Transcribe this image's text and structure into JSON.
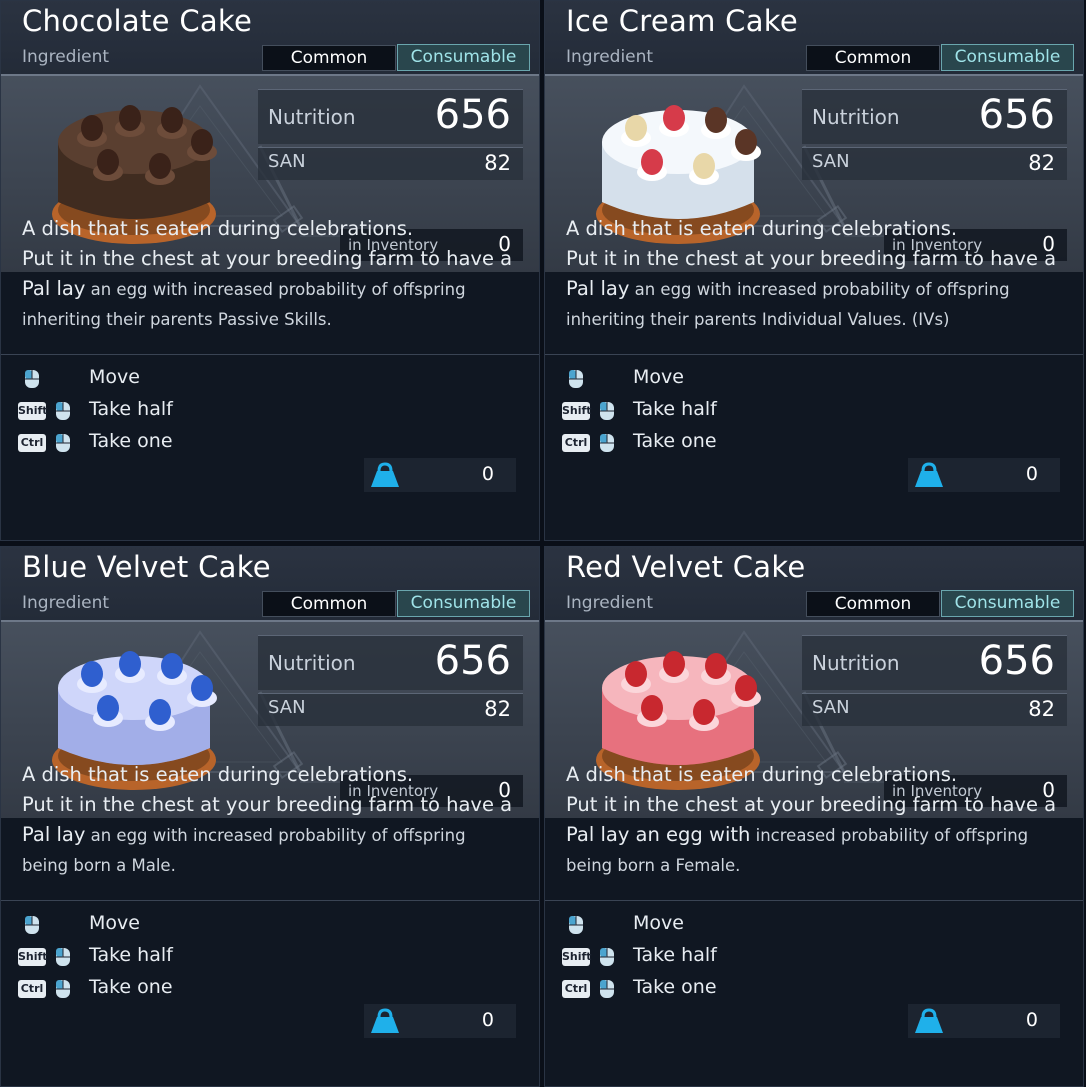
{
  "cards": [
    {
      "title": "Chocolate Cake",
      "category": "Ingredient",
      "rarity": "Common",
      "type": "Consumable",
      "nutrition_label": "Nutrition",
      "nutrition": "656",
      "san_label": "SAN",
      "san": "82",
      "inventory_label": "in Inventory",
      "inventory": "0",
      "desc_line1": "A dish that is eaten during celebrations.",
      "desc_line2": "Put it in the chest at your breeding farm to have a",
      "desc_line3_big": "Pal lay",
      "desc_line3_small": " an egg with increased probability of offspring",
      "desc_line4": "inheriting their parents Passive Skills.",
      "controls": {
        "move": "Move",
        "half_key": "Shift",
        "half": "Take half",
        "one_key": "Ctrl",
        "one": "Take one"
      },
      "weight": "0",
      "colors": {
        "body": "#4a3326",
        "body_dark": "#2e1f17",
        "top": "#5a3f30",
        "frosting": "#6d4c3a",
        "base": "#b8642a"
      },
      "toppings": [
        "#3a2219",
        "#3a2219",
        "#3a2219",
        "#3a2219",
        "#3a2219",
        "#3a2219"
      ],
      "icon_names": [
        "cake-icon",
        "mouse-icon",
        "weight-icon"
      ]
    },
    {
      "title": "Ice Cream Cake",
      "category": "Ingredient",
      "rarity": "Common",
      "type": "Consumable",
      "nutrition_label": "Nutrition",
      "nutrition": "656",
      "san_label": "SAN",
      "san": "82",
      "inventory_label": "in Inventory",
      "inventory": "0",
      "desc_line1": "A dish that is eaten during celebrations.",
      "desc_line2": "Put it in the chest at your breeding farm to have a",
      "desc_line3_big": "Pal lay",
      "desc_line3_small": " an egg with increased probability of offspring",
      "desc_line4": "inheriting their parents Individual Values. (IVs)",
      "controls": {
        "move": "Move",
        "half_key": "Shift",
        "half": "Take half",
        "one_key": "Ctrl",
        "one": "Take one"
      },
      "weight": "0",
      "colors": {
        "body": "#e4edf6",
        "body_dark": "#b9c8d8",
        "top": "#f4f8fc",
        "frosting": "#ffffff",
        "base": "#b8642a"
      },
      "toppings": [
        "#e8d7a8",
        "#d63b4a",
        "#5a3526",
        "#5a3526",
        "#d63b4a",
        "#e8d7a8"
      ],
      "icon_names": [
        "cake-icon",
        "mouse-icon",
        "weight-icon"
      ]
    },
    {
      "title": "Blue Velvet Cake",
      "category": "Ingredient",
      "rarity": "Common",
      "type": "Consumable",
      "nutrition_label": "Nutrition",
      "nutrition": "656",
      "san_label": "SAN",
      "san": "82",
      "inventory_label": "in Inventory",
      "inventory": "0",
      "desc_line1": "A dish that is eaten during celebrations.",
      "desc_line2": "Put it in the chest at your breeding farm to have a",
      "desc_line3_big": "Pal lay",
      "desc_line3_small": " an egg with increased probability of offspring",
      "desc_line4": "being born a Male.",
      "controls": {
        "move": "Move",
        "half_key": "Shift",
        "half": "Take half",
        "one_key": "Ctrl",
        "one": "Take one"
      },
      "weight": "0",
      "colors": {
        "body": "#b3bdf2",
        "body_dark": "#8391d8",
        "top": "#cfd6fa",
        "frosting": "#e7ebff",
        "base": "#b8642a"
      },
      "toppings": [
        "#2f5fcf",
        "#2f5fcf",
        "#2f5fcf",
        "#2f5fcf",
        "#2f5fcf",
        "#2f5fcf"
      ],
      "icon_names": [
        "cake-icon",
        "mouse-icon",
        "weight-icon"
      ]
    },
    {
      "title": "Red Velvet Cake",
      "category": "Ingredient",
      "rarity": "Common",
      "type": "Consumable",
      "nutrition_label": "Nutrition",
      "nutrition": "656",
      "san_label": "SAN",
      "san": "82",
      "inventory_label": "in Inventory",
      "inventory": "0",
      "desc_line1": "A dish that is eaten during celebrations.",
      "desc_line2": "Put it in the chest at your breeding farm to have a",
      "desc_line3_big": "Pal lay an egg with",
      "desc_line3_small": " increased probability of offspring",
      "desc_line4": "being born a Female.",
      "controls": {
        "move": "Move",
        "half_key": "Shift",
        "half": "Take half",
        "one_key": "Ctrl",
        "one": "Take one"
      },
      "weight": "0",
      "colors": {
        "body": "#f2838f",
        "body_dark": "#d4505e",
        "top": "#f6b6bd",
        "frosting": "#fbd6da",
        "base": "#b8642a"
      },
      "toppings": [
        "#c8282f",
        "#c8282f",
        "#c8282f",
        "#c8282f",
        "#c8282f",
        "#c8282f"
      ],
      "icon_names": [
        "cake-icon",
        "mouse-icon",
        "weight-icon"
      ]
    }
  ]
}
